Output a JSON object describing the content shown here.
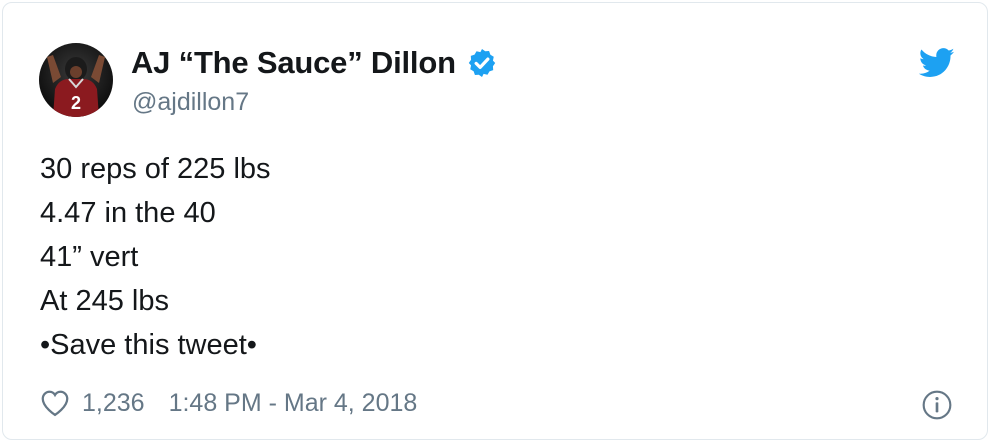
{
  "tweet": {
    "author": {
      "name": "AJ “The Sauce” Dillon",
      "handle": "@ajdillon7",
      "verified": true,
      "avatar_jersey_number": "2"
    },
    "lines": [
      "30 reps of 225 lbs",
      "4.47 in the 40",
      "41” vert",
      "At 245 lbs",
      "•Save this tweet•"
    ],
    "likes": "1,236",
    "timestamp": "1:48 PM - Mar 4, 2018"
  },
  "icons": {
    "verified": "verified-badge-icon",
    "brand": "twitter-bird-icon",
    "like": "heart-icon",
    "info": "info-icon"
  },
  "colors": {
    "twitter_blue": "#1da1f2",
    "text_primary": "#14171a",
    "text_secondary": "#657786",
    "border": "#e1e8ed"
  }
}
